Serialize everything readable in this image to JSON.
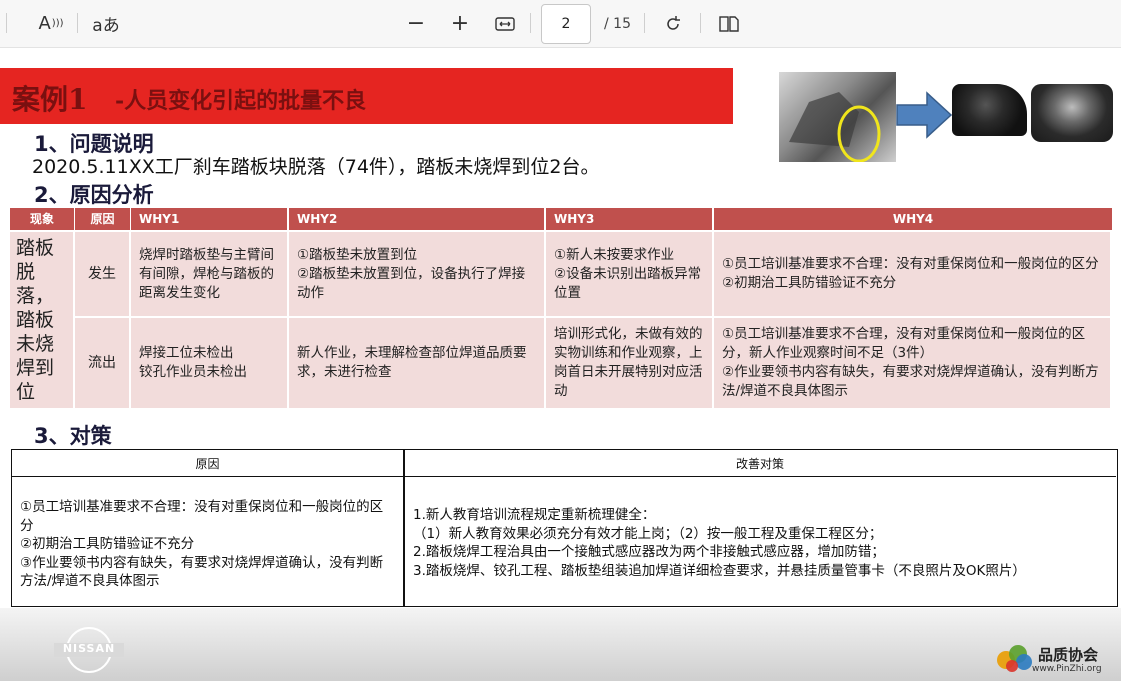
{
  "toolbar": {
    "read_aloud_label": "A",
    "text_options_label": "aあ",
    "zoom_out": "−",
    "zoom_in": "+",
    "current_page": "2",
    "total_pages": "/ 15"
  },
  "slide": {
    "title_main": "案例1",
    "title_sub": "-人员变化引起的批量不良",
    "section1": "1、问题说明",
    "problem": "2020.5.11XX工厂刹车踏板块脱落（74件），踏板未烧焊到位2台。",
    "section2": "2、原因分析",
    "section3": "3、对策"
  },
  "why_table": {
    "headers": [
      "现象",
      "原因",
      "WHY1",
      "WHY2",
      "WHY3",
      "WHY4"
    ],
    "phenomenon": "踏板脱落，踏板未烧焊到位",
    "rows": [
      {
        "cause": "发生",
        "why1": "烧焊时踏板垫与主臂间有间隙，焊枪与踏板的距离发生变化",
        "why2": "①踏板垫未放置到位\n②踏板垫未放置到位，设备执行了焊接动作",
        "why3": "①新人未按要求作业\n②设备未识别出踏板异常位置",
        "why4": "①员工培训基准要求不合理：没有对重保岗位和一般岗位的区分\n②初期治工具防错验证不充分"
      },
      {
        "cause": "流出",
        "why1": "焊接工位未检出\n铰孔作业员未检出",
        "why2": "新人作业，未理解检查部位焊道品质要求，未进行检查",
        "why3": "培训形式化，未做有效的实物训练和作业观察，上岗首日未开展特别对应活动",
        "why4": "①员工培训基准要求不合理，没有对重保岗位和一般岗位的区分，新人作业观察时间不足（3件）\n②作业要领书内容有缺失，有要求对烧焊焊道确认，没有判断方法/焊道不良具体图示"
      }
    ]
  },
  "countermeasure": {
    "header_cause": "原因",
    "header_measure": "改善对策",
    "cause_text": "①员工培训基准要求不合理：没有对重保岗位和一般岗位的区分\n②初期治工具防错验证不充分\n③作业要领书内容有缺失，有要求对烧焊焊道确认，没有判断方法/焊道不良具体图示",
    "measure_text": "1.新人教育培训流程规定重新梳理健全：\n（1）新人教育效果必须充分有效才能上岗；（2）按一般工程及重保工程区分；\n2.踏板烧焊工程治具由一个接触式感应器改为两个非接触式感应器，增加防错；\n3.踏板烧焊、铰孔工程、踏板垫组装追加焊道详细检查要求，并悬挂质量管事卡（不良照片及OK照片）"
  },
  "footer": {
    "logo_text": "NISSAN",
    "brand_name": "品质协会",
    "brand_url": "www.PinZhi.org"
  },
  "colors": {
    "title_red": "#e52521",
    "table_header": "#c0504d",
    "table_body": "#f2dcdb",
    "arrow_blue": "#4f81bd"
  }
}
